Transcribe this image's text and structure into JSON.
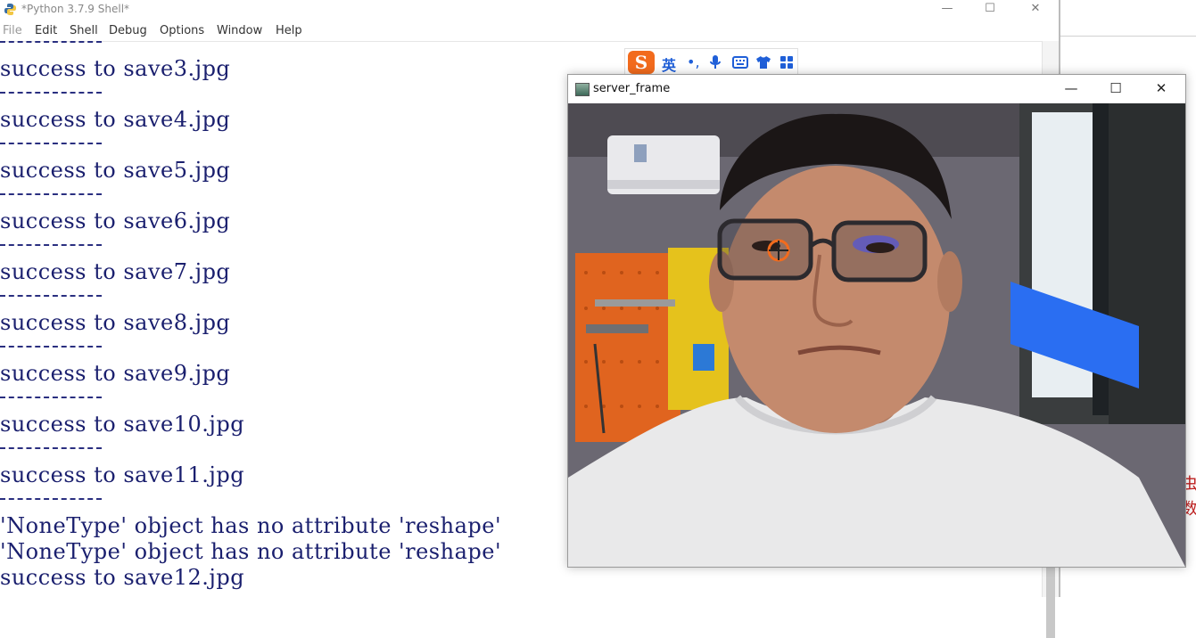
{
  "shell": {
    "title": "*Python 3.7.9 Shell*",
    "menu": [
      "File",
      "Edit",
      "Shell",
      "Debug",
      "Options",
      "Window",
      "Help"
    ],
    "window_controls": {
      "minimize": "—",
      "maximize": "☐",
      "close": "✕"
    },
    "output_lines": [
      "success to save3.jpg",
      "success to save4.jpg",
      "success to save5.jpg",
      "success to save6.jpg",
      "success to save7.jpg",
      "success to save8.jpg",
      "success to save9.jpg",
      "success to save10.jpg",
      "success to save11.jpg",
      "'NoneType' object has no attribute 'reshape'",
      "'NoneType' object has no attribute 'reshape'",
      "success to save12.jpg"
    ]
  },
  "ime_toolbar": {
    "logo": "S",
    "mode": "英",
    "punct": "•,",
    "icons": [
      "microphone-icon",
      "keyboard-icon",
      "shirt-icon",
      "grid-icon"
    ]
  },
  "server_frame": {
    "title": "server_frame",
    "window_controls": {
      "minimize": "—",
      "maximize": "☐",
      "close": "✕"
    }
  },
  "background_text": "虫\n数"
}
